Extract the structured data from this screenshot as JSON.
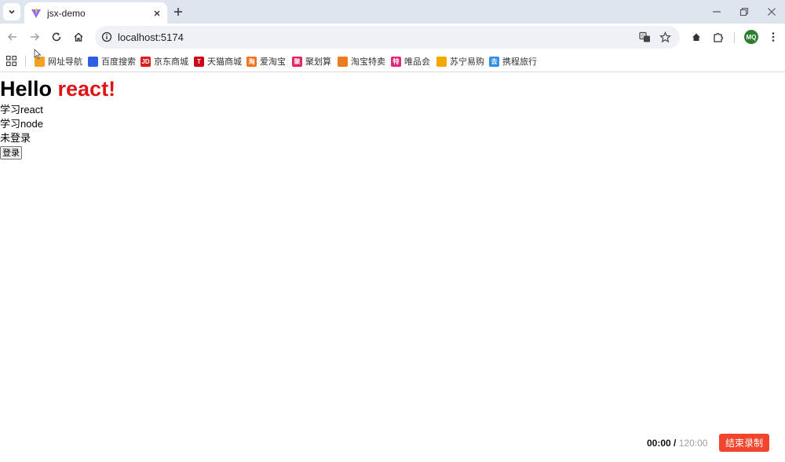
{
  "browser": {
    "tab": {
      "title": "jsx-demo"
    },
    "address_bar": {
      "url": "localhost:5174"
    },
    "profile": {
      "initials": "MQ"
    }
  },
  "bookmarks": [
    {
      "label": "网址导航",
      "icon": "hao123-icon",
      "color": "#f4a020"
    },
    {
      "label": "百度搜索",
      "icon": "baidu-paw-icon",
      "color": "#2e5ee6"
    },
    {
      "label": "京东商城",
      "icon": "jd-icon",
      "color": "#d81e1e",
      "text": "JD"
    },
    {
      "label": "天猫商城",
      "icon": "tmall-icon",
      "color": "#d0021b",
      "text": "T"
    },
    {
      "label": "爱淘宝",
      "icon": "aitaobao-icon",
      "color": "#f07522",
      "text": "淘"
    },
    {
      "label": "聚划算",
      "icon": "juhuasuan-icon",
      "color": "#e5235f",
      "text": "聚"
    },
    {
      "label": "淘宝特卖",
      "icon": "taobao-temai-icon",
      "color": "#f07a22"
    },
    {
      "label": "唯品会",
      "icon": "vip-icon",
      "color": "#e5237a",
      "text": "特"
    },
    {
      "label": "苏宁易购",
      "icon": "suning-icon",
      "color": "#f5a800"
    },
    {
      "label": "携程旅行",
      "icon": "ctrip-icon",
      "color": "#2f8ee6",
      "text": "去"
    }
  ],
  "page": {
    "heading_prefix": "Hello ",
    "heading_name": "react!",
    "list": [
      "学习react",
      "学习node"
    ],
    "status": "未登录",
    "login_button": "登录"
  },
  "recorder": {
    "current": "00:00",
    "separator": " / ",
    "total": "120:00",
    "stop_label": "结束录制"
  },
  "colors": {
    "accent_red": "#e01414",
    "recorder_button": "#f1452d"
  }
}
